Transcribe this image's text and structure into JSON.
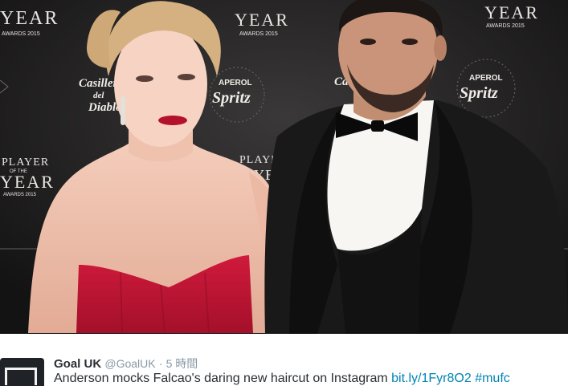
{
  "photo": {
    "backdrop_texts": {
      "year_left": "YEAR",
      "awards_left": "AWARDS 2015",
      "year_center": "YEAR",
      "awards_center": "AWARDS 2015",
      "year_right": "YEAR",
      "awards_right": "AWARDS 2015",
      "player_left": "PLAYER",
      "of_the_left": "OF THE",
      "year_left2": "YEAR",
      "awards_left2": "AWARDS 2015",
      "player_center": "PLAYER",
      "year_center2": "YEAR",
      "casillero_1": "Casillero",
      "del_1": "del",
      "diablo_1": "Diablo",
      "aperol_1": "APEROL",
      "spritz_1": "Spritz",
      "aperol_2": "APEROL",
      "spritz_2": "Spritz",
      "casillero_2": "Ca"
    }
  },
  "tweet": {
    "name": "Goal UK",
    "handle": "@GoalUK",
    "separator": "·",
    "time": "5 時間",
    "text": "Anderson mocks Falcao's daring new haircut on Instagram ",
    "link": "bit.ly/1Fyr8O2",
    "hashtag": "#mufc"
  }
}
